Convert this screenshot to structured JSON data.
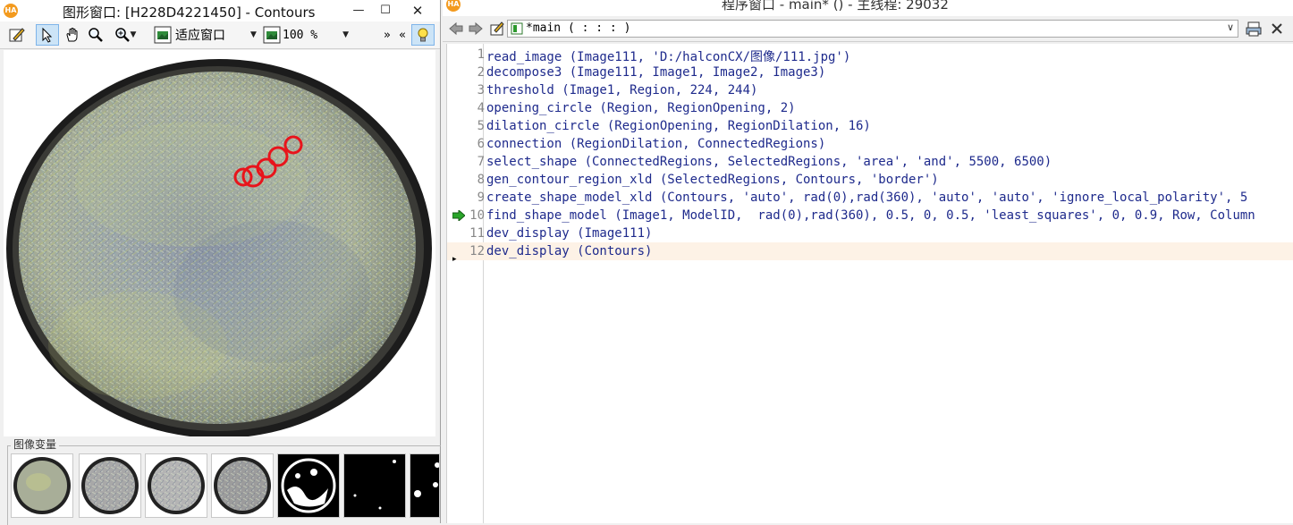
{
  "graphics_window": {
    "logo": "HA",
    "title": "图形窗口: [H228D4221450] - Contours",
    "toolbar": {
      "fit_label": "适应窗口",
      "zoom_value": "100 %",
      "overflow": "»",
      "collapse": "«"
    },
    "icons": [
      "edit-icon",
      "pointer-icon",
      "hand-icon",
      "magnifier-icon",
      "fit-window-icon",
      "zoom-icon",
      "lightbulb-icon"
    ],
    "variables_label": "图像变量",
    "thumbnails": [
      "Image111",
      "Image1",
      "Image2",
      "Image3",
      "Region",
      "RegionOpening",
      "ConnectedRegions"
    ]
  },
  "program_window": {
    "logo": "HA",
    "title": "程序窗口 - main* () - 主线程: 29032",
    "procedure": "*main ( : : : )",
    "current_line": 10,
    "lines": [
      {
        "n": "1",
        "text": "read_image (Image111, 'D:/halconCX/图像/111.jpg')"
      },
      {
        "n": "2",
        "text": "decompose3 (Image111, Image1, Image2, Image3)"
      },
      {
        "n": "3",
        "text": "threshold (Image1, Region, 224, 244)"
      },
      {
        "n": "4",
        "text": "opening_circle (Region, RegionOpening, 2)"
      },
      {
        "n": "5",
        "text": "dilation_circle (RegionOpening, RegionDilation, 16)"
      },
      {
        "n": "6",
        "text": "connection (RegionDilation, ConnectedRegions)"
      },
      {
        "n": "7",
        "text": "select_shape (ConnectedRegions, SelectedRegions, 'area', 'and', 5500, 6500)"
      },
      {
        "n": "8",
        "text": "gen_contour_region_xld (SelectedRegions, Contours, 'border')"
      },
      {
        "n": "9",
        "text": "create_shape_model_xld (Contours, 'auto', rad(0),rad(360), 'auto', 'auto', 'ignore_local_polarity', 5"
      },
      {
        "n": "10",
        "text": "find_shape_model (Image1, ModelID,  rad(0),rad(360), 0.5, 0, 0.5, 'least_squares', 0, 0.9, Row, Column"
      },
      {
        "n": "11",
        "text": "dev_display (Image111)"
      },
      {
        "n": "12",
        "text": "dev_display (Contours)"
      }
    ]
  },
  "colors": {
    "code_text": "#1e2a8c",
    "contour": "#e8141b",
    "active_line": "#fdf2e6",
    "pc_arrow": "#2aa52a"
  }
}
